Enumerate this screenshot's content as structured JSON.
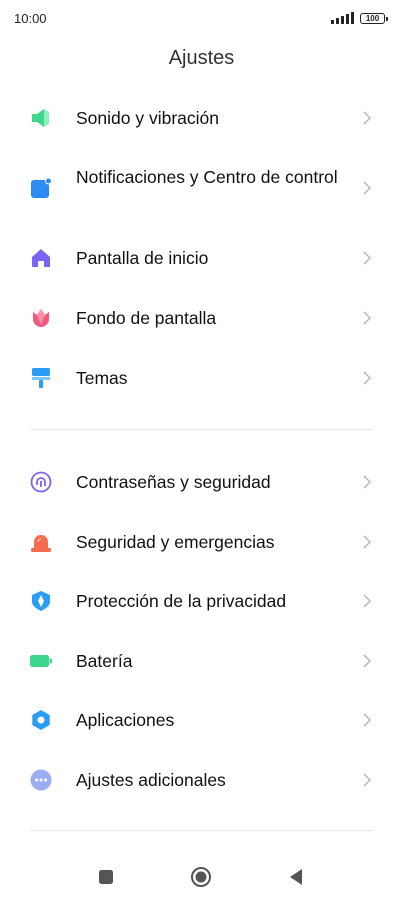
{
  "status_bar": {
    "time": "10:00",
    "battery": "100"
  },
  "page": {
    "title": "Ajustes"
  },
  "section1": [
    {
      "label": "Sonido y vibración",
      "icon": "speaker-icon",
      "color": "#3dd68c"
    },
    {
      "label": "Notificaciones y Centro de control",
      "icon": "notification-icon",
      "color": "#2c8cf4"
    },
    {
      "label": "Pantalla de inicio",
      "icon": "home-icon",
      "color": "#7b63f5"
    },
    {
      "label": "Fondo de pantalla",
      "icon": "tulip-icon",
      "color": "#f05a7e"
    },
    {
      "label": "Temas",
      "icon": "paint-roller-icon",
      "color": "#2a9df4"
    }
  ],
  "section2": [
    {
      "label": "Contraseñas y seguridad",
      "icon": "fingerprint-icon",
      "color": "#7b63f5"
    },
    {
      "label": "Seguridad y emergencias",
      "icon": "emergency-light-icon",
      "color": "#f46d4f"
    },
    {
      "label": "Protección de la privacidad",
      "icon": "privacy-shield-icon",
      "color": "#2a9df4"
    },
    {
      "label": "Batería",
      "icon": "battery-icon",
      "color": "#3dd68c"
    },
    {
      "label": "Aplicaciones",
      "icon": "gear-icon",
      "color": "#2a9df4"
    },
    {
      "label": "Ajustes adicionales",
      "icon": "more-dots-icon",
      "color": "#9aaef0"
    }
  ],
  "nav_bar": {
    "recents": "square-icon",
    "home": "circle-icon",
    "back": "back-triangle-icon"
  }
}
